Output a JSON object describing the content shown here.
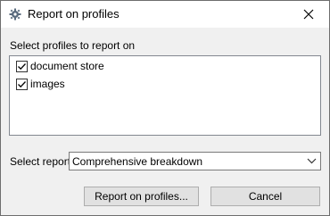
{
  "window": {
    "title": "Report on profiles"
  },
  "icons": {
    "app": "gear-icon",
    "close": "close-icon",
    "check": "check-icon",
    "dropdown": "chevron-down-icon"
  },
  "profiles": {
    "label": "Select profiles to report on",
    "items": [
      {
        "label": "document store",
        "checked": true
      },
      {
        "label": "images",
        "checked": true
      }
    ]
  },
  "report": {
    "label": "Select report",
    "selected": "Comprehensive breakdown"
  },
  "buttons": {
    "report_label": "Report on profiles...",
    "cancel_label": "Cancel"
  },
  "colors": {
    "dialog_bg": "#f0f0f0",
    "titlebar_bg": "#ffffff",
    "button_bg": "#e1e1e1",
    "button_border": "#adadad"
  }
}
